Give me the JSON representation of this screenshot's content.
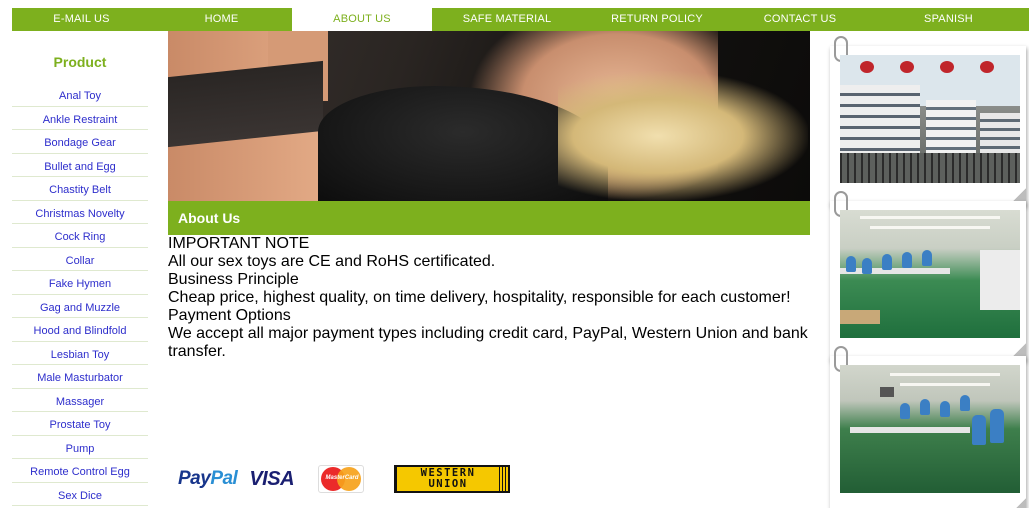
{
  "nav": {
    "items": [
      {
        "label": "E-MAIL US",
        "active": false
      },
      {
        "label": "HOME",
        "active": false
      },
      {
        "label": "ABOUT US",
        "active": true
      },
      {
        "label": "SAFE MATERIAL",
        "active": false
      },
      {
        "label": "RETURN POLICY",
        "active": false
      },
      {
        "label": "CONTACT US",
        "active": false
      },
      {
        "label": "SPANISH",
        "active": false
      }
    ],
    "color": "#7db01e"
  },
  "sidebar": {
    "heading": "Product",
    "items": [
      "Anal Toy",
      "Ankle Restraint",
      "Bondage Gear",
      "Bullet and Egg",
      "Chastity Belt",
      "Christmas Novelty",
      "Cock Ring",
      "Collar",
      "Fake Hymen",
      "Gag and Muzzle",
      "Hood and Blindfold",
      "Lesbian Toy",
      "Male Masturbator",
      "Massager",
      "Prostate Toy",
      "Pump",
      "Remote Control Egg",
      "Sex Dice"
    ],
    "link_color": "#2e2ecc"
  },
  "main": {
    "section_title": "About Us",
    "important_heading": "IMPORTANT NOTE",
    "important_text": "All our sex toys are CE and RoHS certificated.",
    "principle_heading": "Business Principle",
    "principle_text": "Cheap price, highest quality, on time delivery, hospitality, responsible for each customer!",
    "payment_heading": "Payment Options",
    "payment_text": "We accept all major payment types including credit card, PayPal, Western Union and bank transfer.",
    "payment_logos": {
      "paypal_a": "Pay",
      "paypal_b": "Pal",
      "visa": "VISA",
      "mastercard": "MasterCard",
      "western_union_1": "WESTERN",
      "western_union_2": "UNION"
    }
  },
  "photos": [
    {
      "name": "factory-building-photo"
    },
    {
      "name": "production-line-photo-1"
    },
    {
      "name": "production-line-photo-2"
    }
  ]
}
